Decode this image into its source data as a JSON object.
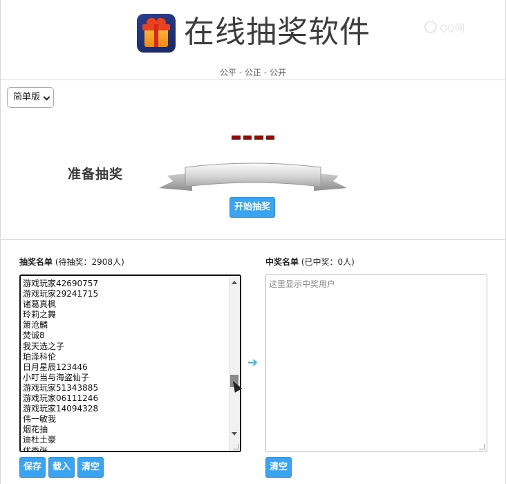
{
  "header": {
    "title": "在线抽奖软件",
    "subtitle": "公平 - 公正 - 公开",
    "watermark": "QQ网"
  },
  "mode_select": {
    "selected": "简单版"
  },
  "draw": {
    "display": "----",
    "banner_text": "准备抽奖",
    "start_button": "开始抽奖"
  },
  "entrants": {
    "title": "抽奖名单",
    "status": "(待抽奖：2908人)",
    "names": [
      "游戏玩家42690757",
      "游戏玩家29241715",
      "诸葛真枫",
      "玲莉之舞",
      "箫沧麟",
      "焚诚8",
      "我天选之子",
      "珀泽科伦",
      "日月星辰123446",
      "小叮当与海盗仙子",
      "游戏玩家51343885",
      "游戏玩家06111246",
      "游戏玩家14094328",
      "伟一敏我",
      "烟花抽",
      "迪杜土豪",
      "优秀张"
    ],
    "buttons": {
      "save": "保存",
      "load": "载入",
      "clear": "清空"
    }
  },
  "winners": {
    "title": "中奖名单",
    "status": "(已中奖：0人)",
    "placeholder": "这里显示中奖用户",
    "clear_button": "清空"
  },
  "colors": {
    "accent": "#3aa3f2",
    "display_dash": "#8b0a0a",
    "arrow": "#38b6e0"
  }
}
